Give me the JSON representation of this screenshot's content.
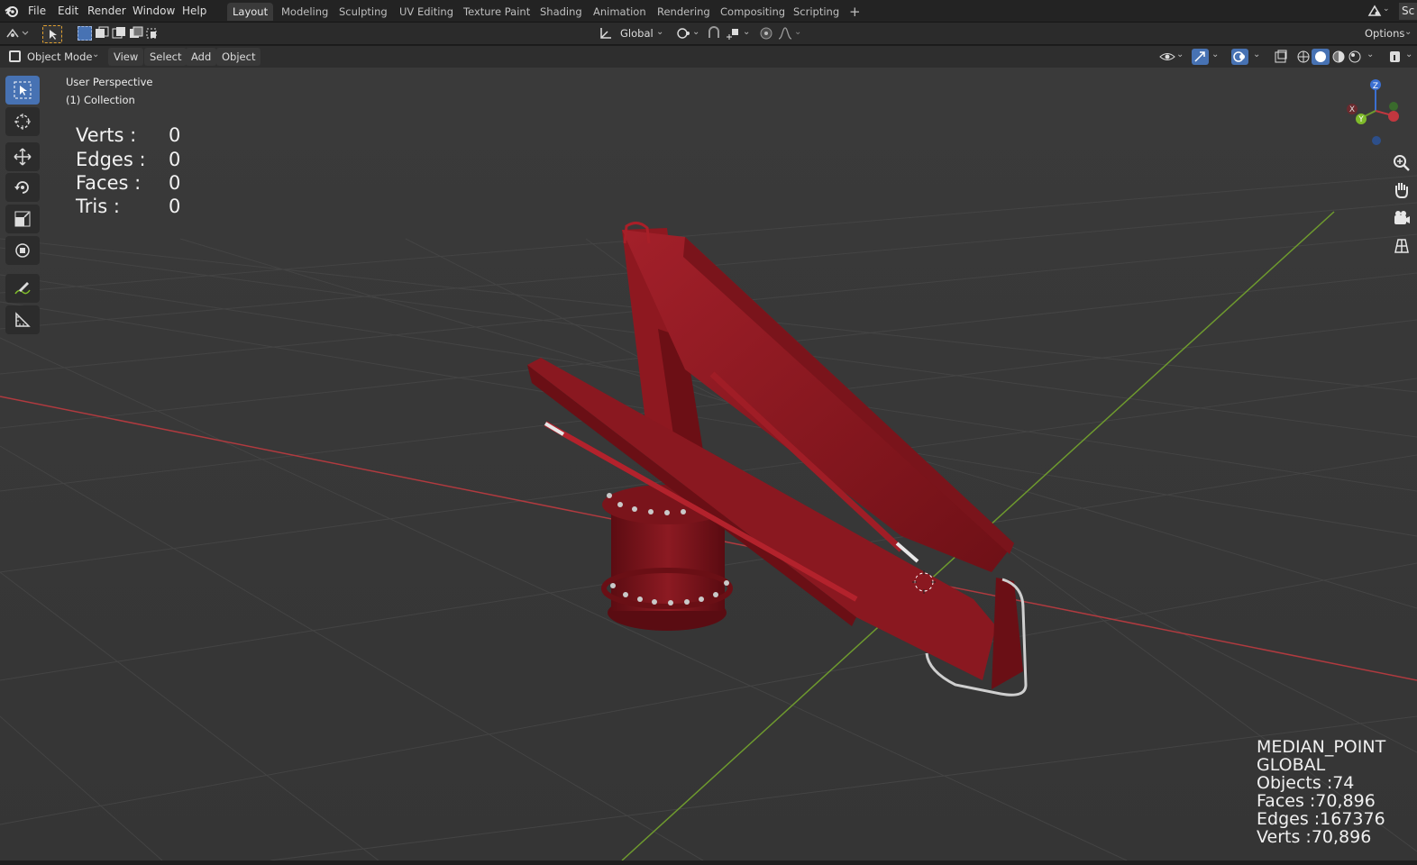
{
  "menubar": {
    "items": [
      "File",
      "Edit",
      "Render",
      "Window",
      "Help"
    ],
    "workspaces": [
      "Layout",
      "Modeling",
      "Sculpting",
      "UV Editing",
      "Texture Paint",
      "Shading",
      "Animation",
      "Rendering",
      "Compositing",
      "Scripting"
    ],
    "active_workspace": "Layout",
    "add_tab": "+",
    "scene_label": "Sc"
  },
  "tool_header": {
    "orientation": "Global",
    "options": "Options"
  },
  "view_header": {
    "mode": "Object Mode",
    "menus": [
      "View",
      "Select",
      "Add",
      "Object"
    ]
  },
  "viewport": {
    "perspective": "User Perspective",
    "collection": "(1) Collection",
    "stats_left": [
      {
        "label": "Verts :",
        "value": "0"
      },
      {
        "label": "Edges :",
        "value": "0"
      },
      {
        "label": "Faces :",
        "value": "0"
      },
      {
        "label": "Tris :",
        "value": "0"
      }
    ],
    "stats_right": [
      "MEDIAN_POINT",
      "GLOBAL",
      "Objects :74",
      "Faces :70,896",
      "Edges :167376",
      "Verts :70,896"
    ],
    "gizmo": {
      "x": "X",
      "y": "Y",
      "z": "Z"
    }
  },
  "colors": {
    "accent": "#4772b3",
    "model_red": "#8f1a22",
    "axis_x": "#c2373f",
    "axis_y": "#6e9a2e",
    "grid_bg": "#393939"
  }
}
